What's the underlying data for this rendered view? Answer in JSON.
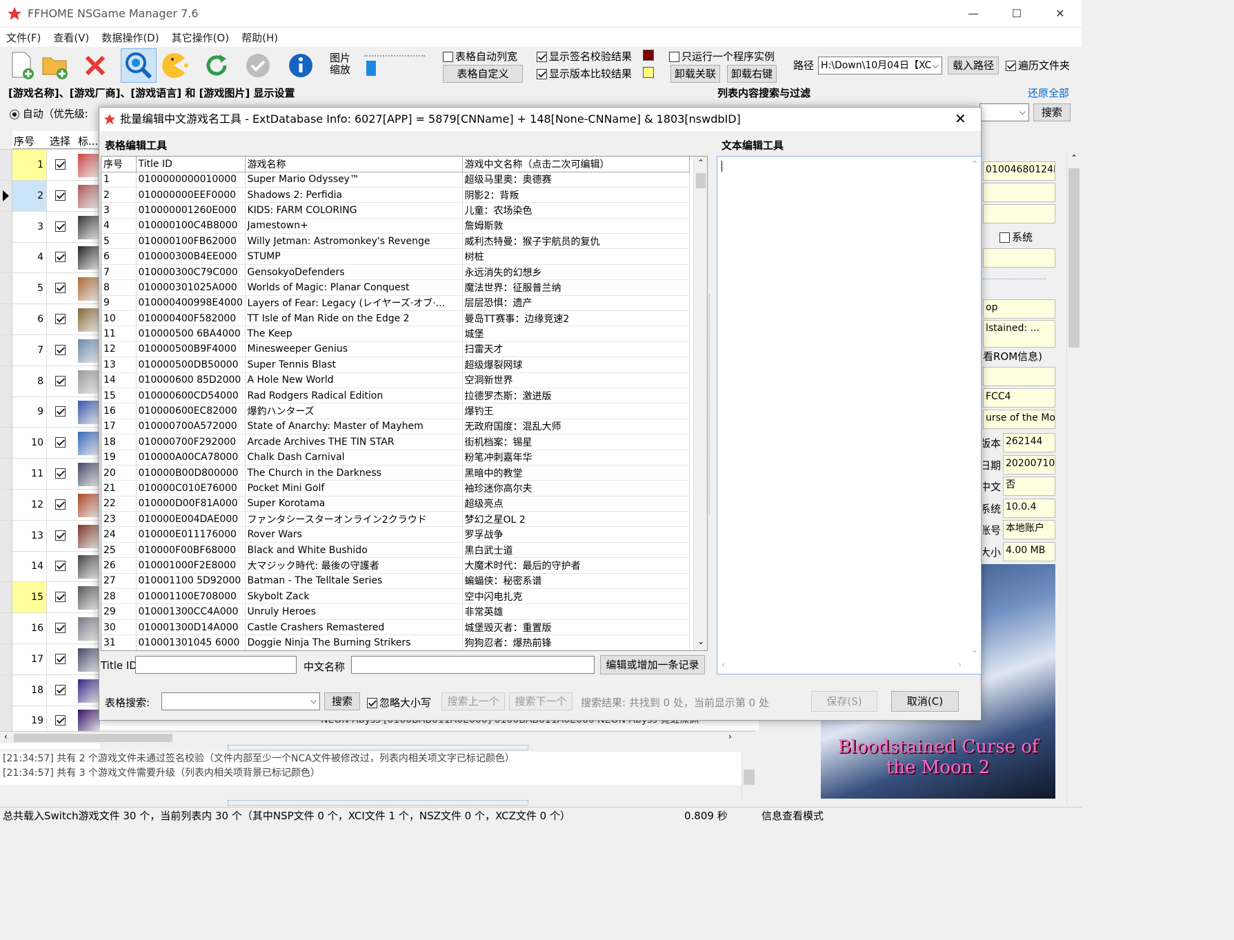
{
  "window": {
    "title": "FFHOME NSGame Manager 7.6",
    "min": "—",
    "max": "☐",
    "close": "✕"
  },
  "menu": [
    "文件(F)",
    "查看(V)",
    "数据操作(D)",
    "其它操作(O)",
    "帮助(H)"
  ],
  "toolbar": {
    "thumb_label": "图片缩放",
    "auto_col": "表格自动列宽",
    "custom_table": "表格自定义",
    "show_sig": "显示签名校验结果",
    "show_ver": "显示版本比较结果",
    "single_instance": "只运行一个程序实例",
    "unload_assoc": "卸载关联",
    "unload_right": "卸载右键",
    "path_label": "路径",
    "path_value": "H:\\Down\\10月04日【XC",
    "load_path": "载入路径",
    "traverse": "遍历文件夹"
  },
  "settings_bar": {
    "title": "[游戏名称]、[游戏厂商]、[游戏语言] 和 [游戏图片] 显示设置",
    "auto_label": "自动（优先级:",
    "filter_title": "列表内容搜索与过滤",
    "restore_all": "还原全部",
    "search": "搜索"
  },
  "bg_list": {
    "headers": [
      "序号",
      "选择",
      "标..."
    ],
    "rows": [
      "1",
      "2",
      "3",
      "4",
      "5",
      "6",
      "7",
      "8",
      "9",
      "10",
      "11",
      "12",
      "13",
      "14",
      "15",
      "16",
      "17",
      "18",
      "19"
    ],
    "partial_row": "NEON Abyss  [0100BAB011A0E000]  0100BAB011A0E000  NEON Abyss  霓虹深渊"
  },
  "dialog": {
    "title": "批量编辑中文游戏名工具 - ExtDatabase Info: 6027[APP] = 5879[CNName] + 148[None-CNName]  & 1803[nswdbID]",
    "table_tool": "表格编辑工具",
    "text_tool": "文本编辑工具",
    "columns": [
      "序号",
      "Title ID",
      "游戏名称",
      "游戏中文名称（点击二次可编辑）"
    ],
    "rows": [
      [
        "1",
        "0100000000010000",
        "Super Mario Odyssey™",
        "超级马里奥：奥德赛"
      ],
      [
        "2",
        "010000000EEF0000",
        "Shadows 2: Perfidia",
        "阴影2：背叛"
      ],
      [
        "3",
        "010000001260E000",
        "KIDS: FARM COLORING",
        "儿童：农场染色"
      ],
      [
        "4",
        "010000100C4B8000",
        "Jamestown+",
        "詹姆斯敦"
      ],
      [
        "5",
        "010000100FB62000",
        "Willy Jetman: Astromonkey's Revenge",
        "威利杰特曼：猴子宇航员的复仇"
      ],
      [
        "6",
        "010000300B4EE000",
        "STUMP",
        "树桩"
      ],
      [
        "7",
        "010000300C79C000",
        "GensokyoDefenders",
        "永远消失的幻想乡"
      ],
      [
        "8",
        "010000301025A000",
        "Worlds of Magic: Planar Conquest",
        "魔法世界：征服普兰纳"
      ],
      [
        "9",
        "010000400998E4000",
        "Layers of Fear: Legacy (レイヤーズ·オブ·...",
        "层层恐惧：遗产"
      ],
      [
        "10",
        "010000400F582000",
        "TT Isle of Man Ride on the Edge 2",
        "曼岛TT赛事：边缘竞速2"
      ],
      [
        "11",
        "010000500 6BA4000",
        "The Keep",
        "城堡"
      ],
      [
        "12",
        "010000500B9F4000",
        "Minesweeper Genius",
        "扫雷天才"
      ],
      [
        "13",
        "010000500DB50000",
        "Super Tennis Blast",
        "超级爆裂网球"
      ],
      [
        "14",
        "010000600 85D2000",
        "A Hole New World",
        "空洞新世界"
      ],
      [
        "15",
        "010000600CD54000",
        "Rad Rodgers Radical Edition",
        "拉德罗杰斯：激进版"
      ],
      [
        "16",
        "010000600EC82000",
        "爆釣ハンターズ",
        "爆钓王"
      ],
      [
        "17",
        "010000700A572000",
        "State of Anarchy: Master of Mayhem",
        "无政府国度：混乱大师"
      ],
      [
        "18",
        "010000700F292000",
        "Arcade Archives THE TIN STAR",
        "街机档案：锡星"
      ],
      [
        "19",
        "010000A00CA78000",
        "Chalk Dash Carnival",
        "粉笔冲刺嘉年华"
      ],
      [
        "20",
        "010000B00D800000",
        "The Church in the Darkness",
        "黑暗中的教堂"
      ],
      [
        "21",
        "010000C010E76000",
        "Pocket Mini Golf",
        "袖珍迷你高尔夫"
      ],
      [
        "22",
        "010000D00F81A000",
        "Super Korotama",
        "超级亮点"
      ],
      [
        "23",
        "010000E004DAE000",
        "ファンタシースターオンライン2クラウド",
        "梦幻之星OL 2"
      ],
      [
        "24",
        "010000E011176000",
        "Rover Wars",
        "罗孚战争"
      ],
      [
        "25",
        "010000F00BF68000",
        "Black and White Bushido",
        "黑白武士道"
      ],
      [
        "26",
        "010001000F2E8000",
        "大マジック時代: 最後の守護者",
        "大魔术时代：最后的守护者"
      ],
      [
        "27",
        "010001100 5D92000",
        "Batman - The Telltale Series",
        "蝙蝠侠：秘密系谱"
      ],
      [
        "28",
        "010001100E708000",
        "Skybolt Zack",
        "空中闪电扎克"
      ],
      [
        "29",
        "010001300CC4A000",
        "Unruly Heroes",
        "非常英雄"
      ],
      [
        "30",
        "010001300D14A000",
        "Castle Crashers Remastered",
        "城堡毁灭者：重置版"
      ],
      [
        "31",
        "010001301045 6000",
        "Doggie Ninja The Burning Strikers",
        "狗狗忍者：爆热前锋"
      ]
    ],
    "titleid_label": "Title ID",
    "cnname_label": "中文名称",
    "edit_add": "编辑或增加一条记录",
    "search_label": "表格搜索:",
    "search_btn": "搜索",
    "ignore_case": "忽略大小写",
    "prev": "搜索上一个",
    "next": "搜索下一个",
    "result": "搜索结果: 共找到 0 处，当前显示第 0 处",
    "save": "保存(S)",
    "cancel": "取消(C)"
  },
  "right_panel": {
    "tid_partial": "01004680124E60",
    "system": "系统",
    "op_partial": "op",
    "stained_partial": "lstained: ...",
    "rom_info": "看ROM信息)",
    "fcc4": "FCC4",
    "name_partial": "urse of the Moon",
    "rows": [
      {
        "label": "版本",
        "value": "262144"
      },
      {
        "label": "日期",
        "value": "20200710"
      },
      {
        "label": "中文",
        "value": "否"
      },
      {
        "label": "系统",
        "value": "10.0.4"
      },
      {
        "label": "账号",
        "value": "本地账户"
      },
      {
        "label": "大小",
        "value": "4.00 MB"
      }
    ],
    "cover_text": "Bloodstained Curse of the Moon 2"
  },
  "log": [
    "[21:34:57] 共有 2 个游戏文件未通过签名校验（文件内部至少一个NCA文件被修改过，列表内相关项文字已标记颜色）",
    "[21:34:57] 共有 3 个游戏文件需要升级（列表内相关项背景已标记颜色）"
  ],
  "status": {
    "summary": "总共载入Switch游戏文件 30 个，当前列表内 30 个（其中NSP文件 0 个，XCI文件 1 个，NSZ文件 0 个，XCZ文件 0 个）",
    "time": "0.809 秒",
    "mode": "信息查看模式"
  },
  "colors": {
    "sig_swatch": "#7a0000",
    "ver_swatch": "#ffff80",
    "highlight": "#ffff99",
    "selection": "#cce4f7"
  }
}
